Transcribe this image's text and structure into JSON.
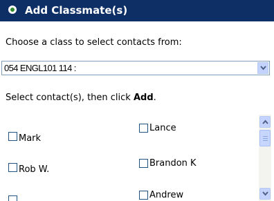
{
  "header": {
    "title": "Add Classmate(s)",
    "icon": "green-dot-icon",
    "background_color": "#0d2f66"
  },
  "class_picker": {
    "label": "Choose a class to select contacts from:",
    "selected_value": "054 ENGL101 114 :"
  },
  "instruction": {
    "prefix": "Select contact(s), then click ",
    "action": "Add",
    "suffix": "."
  },
  "contacts": [
    {
      "name": "Mark",
      "checked": false
    },
    {
      "name": "Lance",
      "checked": false
    },
    {
      "name": "Rob W.",
      "checked": false
    },
    {
      "name": "Brandon K",
      "checked": false
    },
    {
      "name": "",
      "checked": false
    },
    {
      "name": "Andrew",
      "checked": false
    }
  ]
}
